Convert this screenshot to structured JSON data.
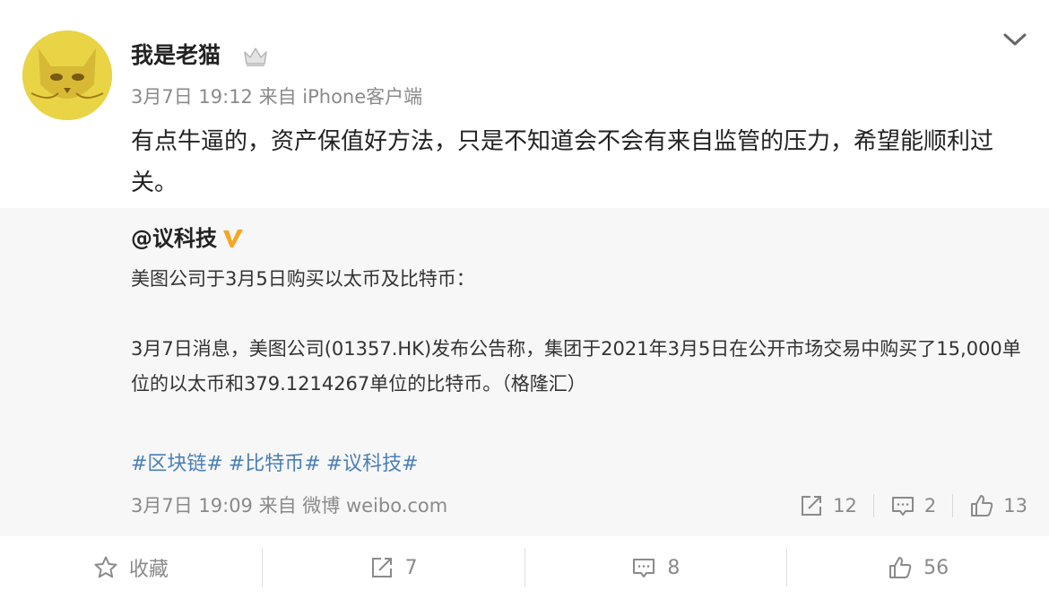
{
  "post": {
    "username": "我是老猫",
    "meta": "3月7日 19:12 来自 iPhone客户端",
    "text": "有点牛逼的，资产保值好方法，只是不知道会不会有来自监管的压力，希望能顺利过关。"
  },
  "repost": {
    "author": "@议科技",
    "line1": "美图公司于3月5日购买以太币及比特币：",
    "line2": "3月7日消息，美图公司(01357.HK)发布公告称，集团于2021年3月5日在公开市场交易中购买了15,000单位的以太币和379.1214267单位的比特币。（格隆汇）",
    "tags": [
      "#区块链#",
      "#比特币#",
      "#议科技#"
    ],
    "meta": "3月7日 19:09 来自 微博 weibo.com",
    "reposts": "12",
    "comments": "2",
    "likes": "13"
  },
  "bottom": {
    "favorite": "收藏",
    "reposts": "7",
    "comments": "8",
    "likes": "56"
  },
  "colors": {
    "link": "#4a7fb5",
    "verified": "#f5a623",
    "muted": "#8a8a8a"
  },
  "icons": [
    "crown-icon",
    "chevron-down-icon",
    "verified-icon",
    "repost-icon",
    "comment-icon",
    "like-icon",
    "star-icon"
  ]
}
